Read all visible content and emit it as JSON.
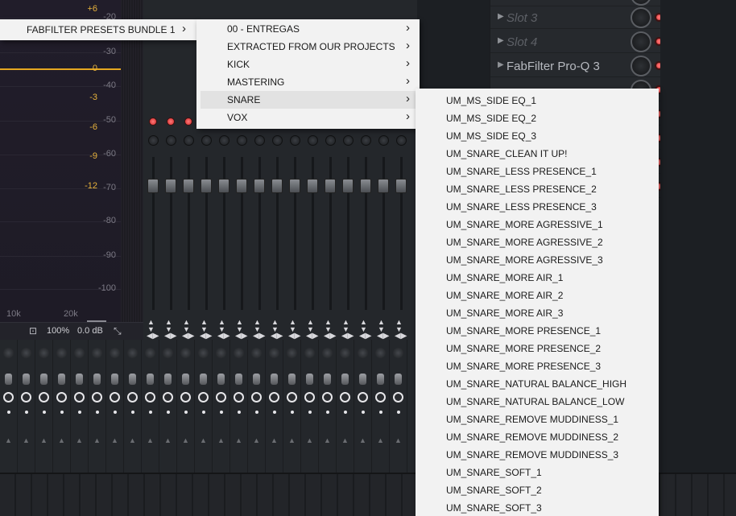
{
  "eq": {
    "gain_labels": [
      "+6",
      "0",
      "-3",
      "-6",
      "-9",
      "-12"
    ],
    "db_labels": [
      "-20",
      "-30",
      "-40",
      "-50",
      "-60",
      "-70",
      "-80",
      "-90",
      "-100"
    ],
    "freq_labels": [
      "10k",
      "20k"
    ],
    "bottom": {
      "zoom": "100%",
      "gain": "0.0 dB"
    }
  },
  "slots": [
    {
      "label": "Slot 3",
      "active": false
    },
    {
      "label": "Slot 4",
      "active": false
    },
    {
      "label": "FabFilter Pro-Q 3",
      "active": true
    }
  ],
  "menus": {
    "level1": {
      "items": [
        {
          "label": "FABFILTER PRESETS BUNDLE 1",
          "has_submenu": true
        }
      ]
    },
    "level2": {
      "items": [
        {
          "label": "00 - ENTREGAS",
          "has_submenu": true
        },
        {
          "label": "EXTRACTED FROM OUR PROJECTS",
          "has_submenu": true
        },
        {
          "label": "KICK",
          "has_submenu": true
        },
        {
          "label": "MASTERING",
          "has_submenu": true
        },
        {
          "label": "SNARE",
          "has_submenu": true,
          "highlighted": true
        },
        {
          "label": "VOX",
          "has_submenu": true
        }
      ]
    },
    "level3": {
      "items": [
        "UM_MS_SIDE EQ_1",
        "UM_MS_SIDE EQ_2",
        "UM_MS_SIDE EQ_3",
        "UM_SNARE_CLEAN IT UP!",
        "UM_SNARE_LESS PRESENCE_1",
        "UM_SNARE_LESS PRESENCE_2",
        "UM_SNARE_LESS PRESENCE_3",
        "UM_SNARE_MORE AGRESSIVE_1",
        "UM_SNARE_MORE AGRESSIVE_2",
        "UM_SNARE_MORE AGRESSIVE_3",
        "UM_SNARE_MORE AIR_1",
        "UM_SNARE_MORE AIR_2",
        "UM_SNARE_MORE AIR_3",
        "UM_SNARE_MORE PRESENCE_1",
        "UM_SNARE_MORE PRESENCE_2",
        "UM_SNARE_MORE PRESENCE_3",
        "UM_SNARE_NATURAL BALANCE_HIGH",
        "UM_SNARE_NATURAL BALANCE_LOW",
        "UM_SNARE_REMOVE MUDDINESS_1",
        "UM_SNARE_REMOVE MUDDINESS_2",
        "UM_SNARE_REMOVE MUDDINESS_3",
        "UM_SNARE_SOFT_1",
        "UM_SNARE_SOFT_2",
        "UM_SNARE_SOFT_3"
      ]
    }
  },
  "icons": {
    "submenu_arrow": "chevron-right-icon",
    "slot_expand": "triangle-right-icon",
    "resize": "expand-icon",
    "save": "save-icon"
  },
  "colors": {
    "eq_curve": "#e5a720",
    "gain_label": "#e7b23c",
    "led_red": "#d02828",
    "menu_bg": "#f2f2f2",
    "menu_highlight": "#e2e2e2"
  }
}
